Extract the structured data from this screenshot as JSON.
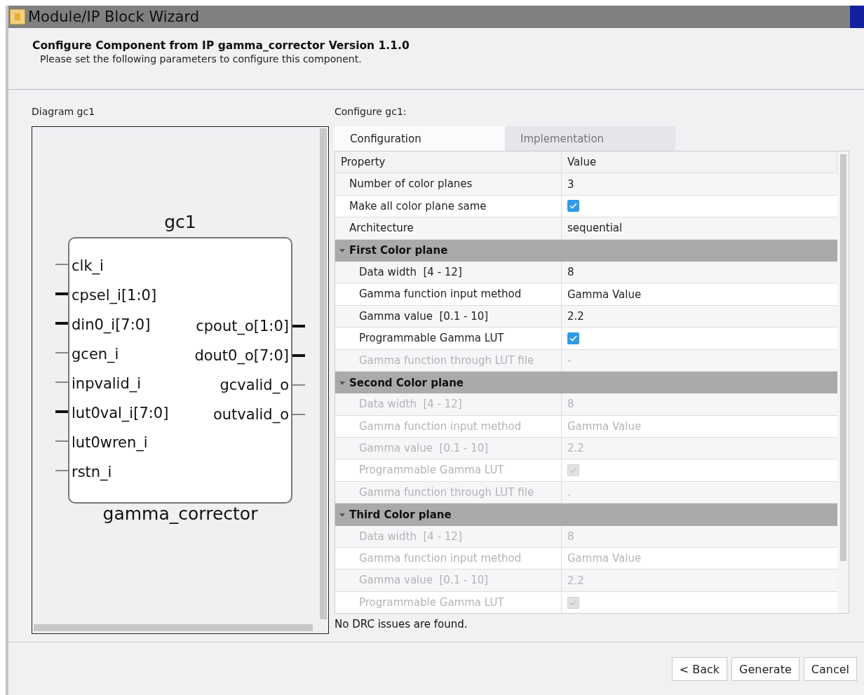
{
  "window": {
    "title": "Module/IP Block Wizard"
  },
  "header": {
    "title": "Configure Component from IP gamma_corrector Version 1.1.0",
    "subtitle": "Please set the following parameters to configure this component."
  },
  "diagram": {
    "label": "Diagram gc1",
    "instance": "gc1",
    "module": "gamma_corrector",
    "inputs": [
      {
        "name": "clk_i",
        "bus": false
      },
      {
        "name": "cpsel_i[1:0]",
        "bus": true
      },
      {
        "name": "din0_i[7:0]",
        "bus": true
      },
      {
        "name": "gcen_i",
        "bus": false
      },
      {
        "name": "inpvalid_i",
        "bus": false
      },
      {
        "name": "lut0val_i[7:0]",
        "bus": true
      },
      {
        "name": "lut0wren_i",
        "bus": false
      },
      {
        "name": "rstn_i",
        "bus": false
      }
    ],
    "outputs": [
      {
        "name": "cpout_o[1:0]",
        "bus": true
      },
      {
        "name": "dout0_o[7:0]",
        "bus": true
      },
      {
        "name": "gcvalid_o",
        "bus": false
      },
      {
        "name": "outvalid_o",
        "bus": false
      }
    ]
  },
  "configure": {
    "label": "Configure gc1:",
    "tabs": [
      {
        "label": "Configuration",
        "selected": true
      },
      {
        "label": "Implementation",
        "selected": false
      }
    ],
    "columns": [
      "Property",
      "Value"
    ],
    "rows": [
      {
        "kind": "property",
        "name": "Number of color planes",
        "value": "3",
        "disabled": false,
        "indent": false
      },
      {
        "kind": "check",
        "name": "Make all color plane same",
        "checked": true,
        "disabled": false,
        "indent": false
      },
      {
        "kind": "property",
        "name": "Architecture",
        "value": "sequential",
        "disabled": false,
        "indent": false
      },
      {
        "kind": "group",
        "name": "First Color plane",
        "expanded": true
      },
      {
        "kind": "property",
        "name": "Data width  [4 - 12]",
        "value": "8",
        "disabled": false,
        "indent": true
      },
      {
        "kind": "property",
        "name": "Gamma function input method",
        "value": "Gamma Value",
        "disabled": false,
        "indent": true
      },
      {
        "kind": "property",
        "name": "Gamma value  [0.1 - 10]",
        "value": "2.2",
        "disabled": false,
        "indent": true
      },
      {
        "kind": "check",
        "name": "Programmable Gamma LUT",
        "checked": true,
        "disabled": false,
        "indent": true
      },
      {
        "kind": "property",
        "name": "Gamma function through LUT file",
        "value": "-",
        "disabled": true,
        "indent": true
      },
      {
        "kind": "group",
        "name": "Second Color plane",
        "expanded": true
      },
      {
        "kind": "property",
        "name": "Data width  [4 - 12]",
        "value": "8",
        "disabled": true,
        "indent": true
      },
      {
        "kind": "property",
        "name": "Gamma function input method",
        "value": "Gamma Value",
        "disabled": true,
        "indent": true
      },
      {
        "kind": "property",
        "name": "Gamma value  [0.1 - 10]",
        "value": "2.2",
        "disabled": true,
        "indent": true
      },
      {
        "kind": "check",
        "name": "Programmable Gamma LUT",
        "checked": true,
        "disabled": true,
        "indent": true
      },
      {
        "kind": "property",
        "name": "Gamma function through LUT file",
        "value": ".",
        "disabled": true,
        "indent": true
      },
      {
        "kind": "group",
        "name": "Third Color plane",
        "expanded": true
      },
      {
        "kind": "property",
        "name": "Data width  [4 - 12]",
        "value": "8",
        "disabled": true,
        "indent": true
      },
      {
        "kind": "property",
        "name": "Gamma function input method",
        "value": "Gamma Value",
        "disabled": true,
        "indent": true
      },
      {
        "kind": "property",
        "name": "Gamma value  [0.1 - 10]",
        "value": "2.2",
        "disabled": true,
        "indent": true
      },
      {
        "kind": "check",
        "name": "Programmable Gamma LUT",
        "checked": true,
        "disabled": true,
        "indent": true
      }
    ],
    "status": "No DRC issues are found."
  },
  "buttons": [
    "< Back",
    "Generate",
    "Cancel"
  ]
}
